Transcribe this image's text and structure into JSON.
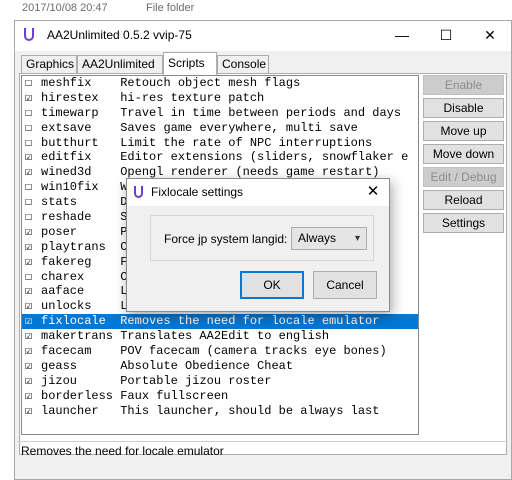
{
  "background": {
    "date_text": "2017/10/08 20:47",
    "type_text": "File folder"
  },
  "window": {
    "title": "AA2Unlimited 0.5.2  vvip-75",
    "minimize": "—",
    "maximize": "☐",
    "close": "✕"
  },
  "tabs": [
    {
      "label": "Graphics"
    },
    {
      "label": "AA2Unlimited"
    },
    {
      "label": "Scripts"
    },
    {
      "label": "Console"
    }
  ],
  "scripts": [
    {
      "check": "☐",
      "name": "meshfix",
      "desc": "Retouch object mesh flags"
    },
    {
      "check": "☑",
      "name": "hirestex",
      "desc": "hi-res texture patch"
    },
    {
      "check": "☐",
      "name": "timewarp",
      "desc": "Travel in time between periods and days"
    },
    {
      "check": "☐",
      "name": "extsave",
      "desc": "Saves game everywhere, multi save"
    },
    {
      "check": "☐",
      "name": "butthurt",
      "desc": "Limit the rate of NPC interruptions"
    },
    {
      "check": "☑",
      "name": "editfix",
      "desc": "Editor extensions (sliders, snowflaker e"
    },
    {
      "check": "☑",
      "name": "wined3d",
      "desc": "Opengl renderer (needs game restart)"
    },
    {
      "check": "☐",
      "name": "win10fix",
      "desc": "W"
    },
    {
      "check": "☐",
      "name": "stats",
      "desc": "D"
    },
    {
      "check": "☐",
      "name": "reshade",
      "desc": "S"
    },
    {
      "check": "☑",
      "name": "poser",
      "desc": "P"
    },
    {
      "check": "☑",
      "name": "playtrans",
      "desc": "C"
    },
    {
      "check": "☑",
      "name": "fakereg",
      "desc": "F"
    },
    {
      "check": "☐",
      "name": "charex",
      "desc": "C"
    },
    {
      "check": "☑",
      "name": "aaface",
      "desc": "L"
    },
    {
      "check": "☑",
      "name": "unlocks",
      "desc": "L"
    },
    {
      "check": "☑",
      "name": "fixlocale",
      "desc": "Removes the need for locale emulator"
    },
    {
      "check": "☑",
      "name": "makertrans",
      "desc": "Translates AA2Edit to english"
    },
    {
      "check": "☑",
      "name": "facecam",
      "desc": "POV facecam (camera tracks eye bones)"
    },
    {
      "check": "☑",
      "name": "geass",
      "desc": "Absolute Obedience Cheat"
    },
    {
      "check": "☑",
      "name": "jizou",
      "desc": "Portable jizou roster"
    },
    {
      "check": "☑",
      "name": "borderless",
      "desc": "Faux fullscreen"
    },
    {
      "check": "☑",
      "name": "launcher",
      "desc": "This launcher, should be always last"
    }
  ],
  "selected_index": 16,
  "buttons": {
    "enable": "Enable",
    "disable": "Disable",
    "move_up": "Move up",
    "move_down": "Move down",
    "edit_debug": "Edit / Debug",
    "reload": "Reload",
    "settings": "Settings"
  },
  "status": "Removes the need for locale emulator",
  "dialog": {
    "title": "Fixlocale settings",
    "close": "✕",
    "label": "Force jp system langid:",
    "select_value": "Always",
    "select_arrow": "▾",
    "ok": "OK",
    "cancel": "Cancel"
  },
  "colors": {
    "selection": "#0078d7",
    "app_icon": "#6a3fcf"
  }
}
